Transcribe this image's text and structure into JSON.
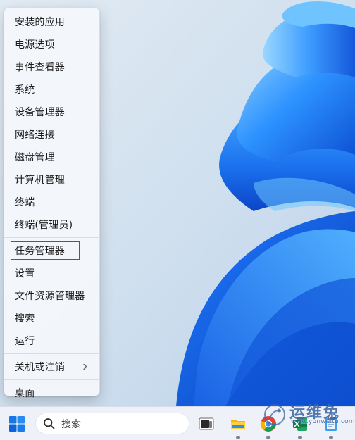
{
  "context_menu": {
    "items": [
      {
        "label": "安装的应用",
        "name": "menu-item-installed-apps"
      },
      {
        "label": "电源选项",
        "name": "menu-item-power-options"
      },
      {
        "label": "事件查看器",
        "name": "menu-item-event-viewer"
      },
      {
        "label": "系统",
        "name": "menu-item-system"
      },
      {
        "label": "设备管理器",
        "name": "menu-item-device-manager"
      },
      {
        "label": "网络连接",
        "name": "menu-item-network-connections"
      },
      {
        "label": "磁盘管理",
        "name": "menu-item-disk-management"
      },
      {
        "label": "计算机管理",
        "name": "menu-item-computer-management"
      },
      {
        "label": "终端",
        "name": "menu-item-terminal"
      },
      {
        "label": "终端(管理员)",
        "name": "menu-item-terminal-admin"
      },
      {
        "label": "任务管理器",
        "name": "menu-item-task-manager"
      },
      {
        "label": "设置",
        "name": "menu-item-settings"
      },
      {
        "label": "文件资源管理器",
        "name": "menu-item-file-explorer"
      },
      {
        "label": "搜索",
        "name": "menu-item-search"
      },
      {
        "label": "运行",
        "name": "menu-item-run"
      },
      {
        "label": "关机或注销",
        "name": "menu-item-shutdown-signout"
      },
      {
        "label": "桌面",
        "name": "menu-item-desktop"
      }
    ],
    "highlighted_item": "任务管理器",
    "submenu_arrow_item": "关机或注销"
  },
  "taskbar": {
    "search_label": "搜索",
    "pinned_apps": [
      {
        "icon": "task-view-icon"
      },
      {
        "icon": "file-explorer-icon"
      },
      {
        "icon": "chrome-icon"
      },
      {
        "icon": "excel-icon"
      },
      {
        "icon": "notepad-icon"
      }
    ]
  },
  "watermark": {
    "brand_text": "运维兔",
    "url_text": "www.yunweitu.com"
  },
  "colors": {
    "highlight": "#e02020",
    "wallpaper_blue": "#1e6fe8",
    "taskbar": "#eff3f8"
  }
}
